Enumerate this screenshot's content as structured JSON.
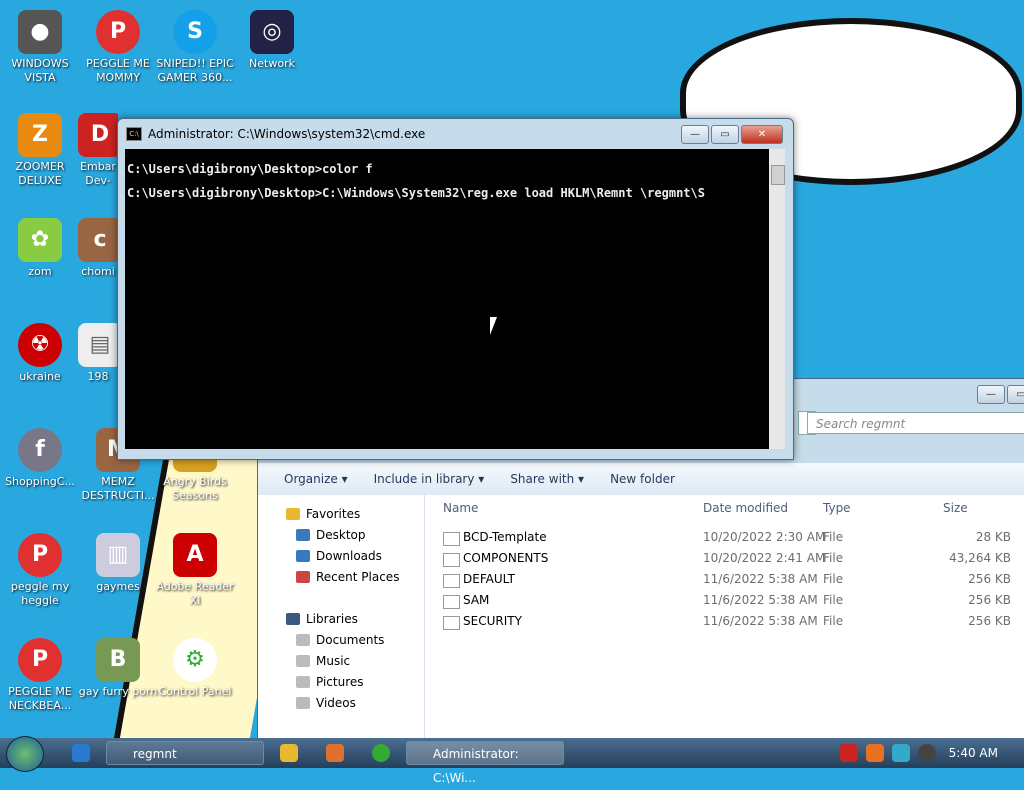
{
  "desktop": {
    "icons": [
      {
        "label": "WINDOWS VISTA"
      },
      {
        "label": "PEGGLE ME MOMMY"
      },
      {
        "label": "SNIPED!! EPIC GAMER 360..."
      },
      {
        "label": "Network"
      },
      {
        "label": "ZOOMER DELUXE"
      },
      {
        "label": "Embar Dev-"
      },
      {
        "label": "zom"
      },
      {
        "label": "chomi"
      },
      {
        "label": "ukraine"
      },
      {
        "label": "198"
      },
      {
        "label": "ShoppingC..."
      },
      {
        "label": "MEMZ DESTRUCTI..."
      },
      {
        "label": "Angry Birds Seasons"
      },
      {
        "label": "peggle my heggle"
      },
      {
        "label": "gaymes"
      },
      {
        "label": "Adobe Reader XI"
      },
      {
        "label": "PEGGLE ME NECKBEA..."
      },
      {
        "label": "gay furry porn"
      },
      {
        "label": "Control Panel"
      }
    ],
    "wallpaper_text": ""
  },
  "cmd": {
    "title": "Administrator: C:\\Windows\\system32\\cmd.exe",
    "lines": [
      "C:\\Users\\digibrony\\Desktop>color f",
      "C:\\Users\\digibrony\\Desktop>C:\\Windows\\System32\\reg.exe load HKLM\\Remnt \\regmnt\\S"
    ]
  },
  "explorer": {
    "search_placeholder": "Search regmnt",
    "toolbar": [
      "Organize ▾",
      "Include in library ▾",
      "Share with ▾",
      "New folder"
    ],
    "nav": [
      "Favorites",
      "Desktop",
      "Downloads",
      "Recent Places",
      "Libraries",
      "Documents",
      "Music",
      "Pictures",
      "Videos"
    ],
    "columns": {
      "name": "Name",
      "date": "Date modified",
      "type": "Type",
      "size": "Size"
    },
    "files": [
      {
        "name": "BCD-Template",
        "date": "10/20/2022 2:30 AM",
        "type": "File",
        "size": "28 KB"
      },
      {
        "name": "COMPONENTS",
        "date": "10/20/2022 2:41 AM",
        "type": "File",
        "size": "43,264 KB"
      },
      {
        "name": "DEFAULT",
        "date": "11/6/2022 5:38 AM",
        "type": "File",
        "size": "256 KB"
      },
      {
        "name": "SAM",
        "date": "11/6/2022 5:38 AM",
        "type": "File",
        "size": "256 KB"
      },
      {
        "name": "SECURITY",
        "date": "11/6/2022 5:38 AM",
        "type": "File",
        "size": "256 KB"
      }
    ]
  },
  "taskbar": {
    "buttons": [
      "regmnt",
      "Administrator: C:\\Wi..."
    ],
    "clock": "5:40 AM"
  },
  "colors": {
    "desktop": "#29a8e0",
    "console_bg": "#000000"
  }
}
